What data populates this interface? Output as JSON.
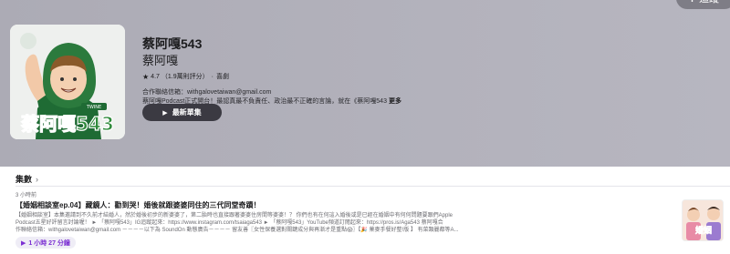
{
  "header": {
    "follow_label": "追蹤",
    "follow_icon": "plus-icon"
  },
  "artwork": {
    "badge": "TWINE",
    "name_text": "蔡阿嘎543",
    "accent_color": "#2f8a3b",
    "bg_color": "#eef0ee"
  },
  "show": {
    "title": "蔡阿嘎543",
    "author": "蔡阿嘎",
    "rating": "4.7",
    "rating_count": "（1.9萬則評分）",
    "separator": "·",
    "genre": "喜劇",
    "desc_line1": "合作聯絡信箱：withgalovetaiwan@gmail.com",
    "desc_line2": "蔡阿嘎Podcast正式開台！最認真最不負責任、政治最不正確的言論，就在《蔡阿嘎543",
    "more_label": "更多",
    "latest_label": "最新單集"
  },
  "episodes": {
    "heading": "集數",
    "items": [
      {
        "time": "3 小時前",
        "title": "【婚姻相談室ep.04】藏鏡人：勸到哭！婚後就跟婆婆同住的三代同堂奇蹟！",
        "desc_line1": "【婚姻相談室】本集邀請到不久前才結婚人，然於婚後初步的新婆婆了，第二胎時也直接跟著婆婆住房間等婆婆！？ 你們也有在何這入婚後或是已經在婚姻中有何何問題要跟們Apple",
        "desc_line2": "Podcast五星好評留言討論喔！ ► 「蔡阿嘎543」IG追蹤起來：https://www.instagram.com/tsaiaga543 ► 「蔡阿嘎543」YouTube頻道訂閱起來：https://pros.is/Aga543 蔡阿嘎合",
        "desc_line3": "作聯絡信箱：withgalovetaiwan@gmail.com －－－－以下為 SoundOn 動態廣告－－－－ 留友善〖女性保養選對關鍵成分與再漸才是重點😱〗【🎉 菓麥手餐好整!版 】 有菜類麗都等A...",
        "duration": "1 小時 27 分鐘"
      }
    ]
  }
}
